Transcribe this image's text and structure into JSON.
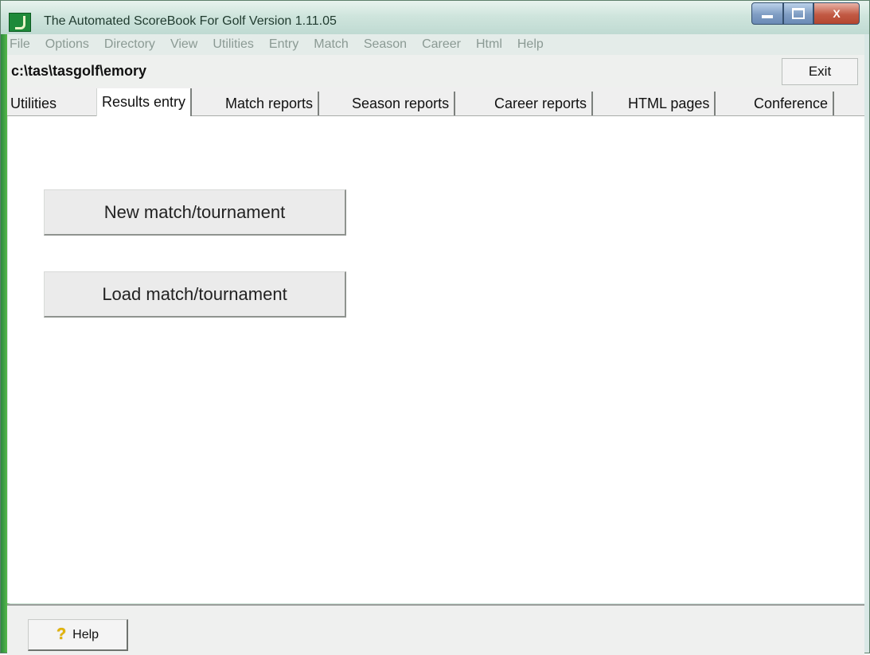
{
  "window": {
    "title": "The Automated ScoreBook For Golf  Version 1.11.05",
    "icon": "golf-scorebook-app-icon",
    "controls": {
      "minimize": "minimize-icon",
      "maximize": "maximize-icon",
      "close_label": "X"
    }
  },
  "menu": [
    "File",
    "Options",
    "Directory",
    "View",
    "Utilities",
    "Entry",
    "Match",
    "Season",
    "Career",
    "Html",
    "Help"
  ],
  "pathbar": {
    "path": "c:\\tas\\tasgolf\\emory",
    "exit_label": "Exit"
  },
  "tabs": {
    "items": [
      "Utilities",
      "Results entry",
      "Match reports",
      "Season reports",
      "Career reports",
      "HTML pages",
      "Conference"
    ],
    "active": "Results entry"
  },
  "main": {
    "new_button": "New match/tournament",
    "load_button": "Load match/tournament"
  },
  "footer": {
    "help_label": "Help",
    "help_icon": "question-mark-icon"
  },
  "colors": {
    "accent": "#55b84a",
    "titlebar": "#cfe5dd",
    "close": "#c25a44"
  }
}
